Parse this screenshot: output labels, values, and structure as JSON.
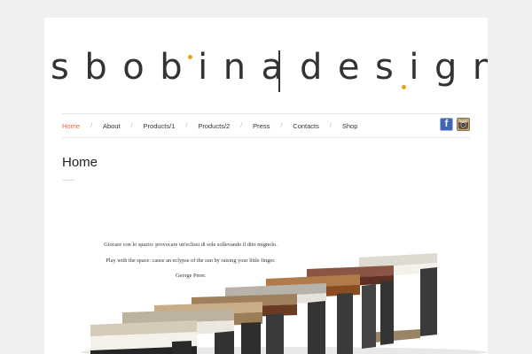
{
  "site": {
    "logo_left": "sbobina",
    "logo_right": "design",
    "accent_color": "#e8a020"
  },
  "nav": {
    "items": [
      {
        "label": "Home",
        "active": true
      },
      {
        "label": "About"
      },
      {
        "label": "Products/1"
      },
      {
        "label": "Products/2"
      },
      {
        "label": "Press"
      },
      {
        "label": "Contacts"
      },
      {
        "label": "Shop"
      }
    ],
    "separator": "/",
    "active_color": "#e16a3c"
  },
  "social": {
    "facebook_glyph": "f",
    "icons": [
      "facebook-icon",
      "instagram-icon"
    ]
  },
  "page": {
    "title": "Home"
  },
  "quote": {
    "line_it": "Giocare con lo spazio: provocare un'eclissi di sole sollevando il dito mignolo.",
    "line_en": "Play with the space: cause an eclypse of the sun by raising your little finger.",
    "author": "George Perec"
  }
}
